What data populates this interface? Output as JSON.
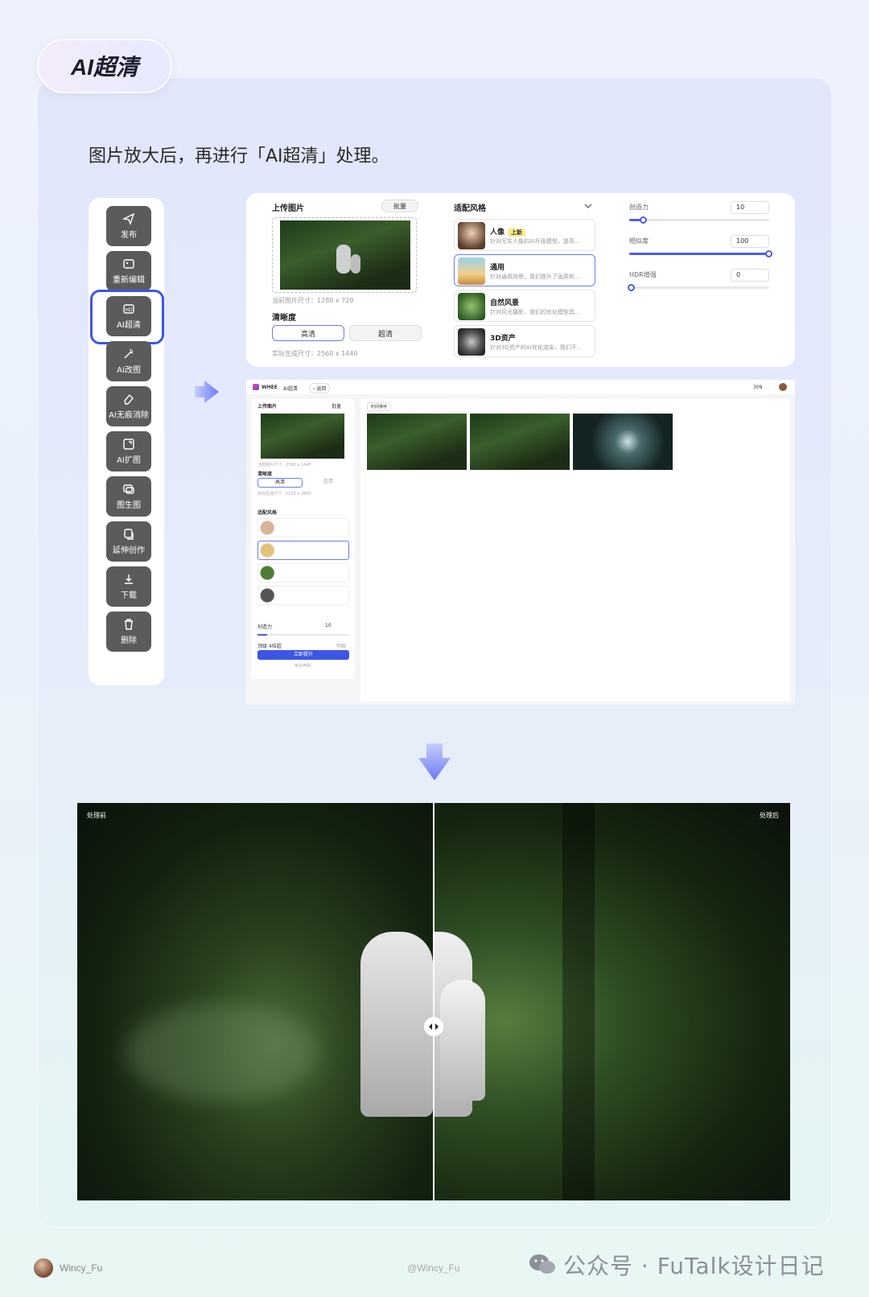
{
  "header": {
    "title": "AI超清",
    "subtitle": "图片放大后，再进行「AI超清」处理。"
  },
  "toolbar": {
    "items": [
      {
        "label": "发布",
        "icon": "send-icon"
      },
      {
        "label": "重新编辑",
        "icon": "edit-image-icon"
      },
      {
        "label": "AI超清",
        "icon": "hd-icon",
        "highlighted": true
      },
      {
        "label": "AI改图",
        "icon": "magic-wand-icon"
      },
      {
        "label": "AI无痕消除",
        "icon": "eraser-icon"
      },
      {
        "label": "AI扩图",
        "icon": "expand-icon"
      },
      {
        "label": "图生图",
        "icon": "image-to-image-icon"
      },
      {
        "label": "延伸创作",
        "icon": "extend-icon"
      },
      {
        "label": "下载",
        "icon": "download-icon"
      },
      {
        "label": "删除",
        "icon": "trash-icon"
      }
    ]
  },
  "panel": {
    "upload_title": "上传图片",
    "batch": "批量",
    "current_size": "当前图片尺寸：1280 x 720",
    "clarity_title": "清晰度",
    "clarity_options": [
      "高清",
      "超清"
    ],
    "actual_size": "实际生成尺寸：2560 x 1440",
    "style_title": "适配风格",
    "styles": [
      {
        "name": "人像",
        "badge": "上新",
        "desc": "针对写实人像的AI升级模型，提高..."
      },
      {
        "name": "通用",
        "desc": "针对通用场景，我们提升了画质和..."
      },
      {
        "name": "自然风景",
        "desc": "针对风光摄影，我们的优化模型具..."
      },
      {
        "name": "3D资产",
        "desc": "针对3D资产的AI优化渲染，我们不..."
      }
    ],
    "sliders": [
      {
        "label": "创造力",
        "value": "10",
        "fraction": 0.1
      },
      {
        "label": "相似度",
        "value": "100",
        "fraction": 1.0
      },
      {
        "label": "HDR增强",
        "value": "0",
        "fraction": 0
      }
    ]
  },
  "app": {
    "brand": "WHEE",
    "page": "AI超清",
    "back": "返回",
    "points": "309",
    "upload_title": "上传图片",
    "batch": "批量",
    "current_size": "当前图片尺寸：2560 x 1440",
    "clarity_title": "清晰度",
    "clarity_options": [
      "高清",
      "超清"
    ],
    "actual_size": "实际生成尺寸：5120 x 2880",
    "style_title": "适配风格",
    "slider_label": "创造力",
    "slider_value": "10",
    "tip": "顶级 4倍超",
    "tip_right": "明细",
    "submit": "立即提升",
    "disclaimer": "免责声明",
    "sort": "时间排序"
  },
  "compare": {
    "before": "处理前",
    "after": "处理后"
  },
  "footer": {
    "author": "Wincy_Fu",
    "handle": "@Wincy_Fu",
    "watermark": "公众号 · FuTalk设计日记"
  }
}
